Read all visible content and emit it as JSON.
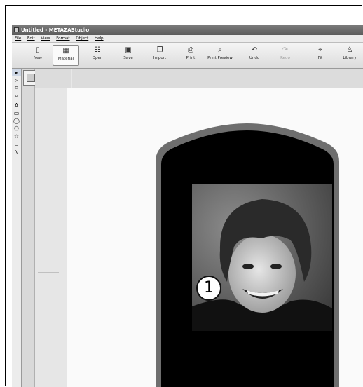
{
  "window": {
    "title": "Untitled - METAZAStudio"
  },
  "menu": {
    "items": [
      "File",
      "Edit",
      "View",
      "Format",
      "Object",
      "Help"
    ]
  },
  "toolbar": {
    "buttons": [
      {
        "label": "New",
        "icon": "new-document-icon",
        "glyph": "▯"
      },
      {
        "label": "Material",
        "icon": "material-icon",
        "glyph": "▦"
      },
      {
        "label": "Open",
        "icon": "open-folder-icon",
        "glyph": "☷"
      },
      {
        "label": "Save",
        "icon": "save-disk-icon",
        "glyph": "▣"
      },
      {
        "label": "Import",
        "icon": "import-icon",
        "glyph": "❐"
      },
      {
        "label": "Print",
        "icon": "printer-icon",
        "glyph": "⎙"
      },
      {
        "label": "Print Preview",
        "icon": "print-preview-icon",
        "glyph": "⌕"
      },
      {
        "label": "Undo",
        "icon": "undo-icon",
        "glyph": "↶"
      },
      {
        "label": "Redo",
        "icon": "redo-icon",
        "glyph": "↷"
      },
      {
        "label": "Fit",
        "icon": "fit-icon",
        "glyph": "⌖"
      },
      {
        "label": "Library",
        "icon": "library-icon",
        "glyph": "♙"
      }
    ]
  },
  "tools": {
    "items": [
      {
        "name": "select-arrow-icon",
        "glyph": "▸"
      },
      {
        "name": "node-select-icon",
        "glyph": "▹"
      },
      {
        "name": "crop-icon",
        "glyph": "⌑"
      },
      {
        "name": "zoom-icon",
        "glyph": "⌕"
      },
      {
        "name": "text-icon",
        "glyph": "A"
      },
      {
        "name": "rectangle-icon",
        "glyph": "▭"
      },
      {
        "name": "ellipse-icon",
        "glyph": "◯"
      },
      {
        "name": "polygon-icon",
        "glyph": "⬠"
      },
      {
        "name": "star-icon",
        "glyph": "☆"
      },
      {
        "name": "line-icon",
        "glyph": "⨽"
      },
      {
        "name": "curve-icon",
        "glyph": "∿"
      }
    ]
  },
  "callout": {
    "number": "1"
  },
  "colors": {
    "shape_fill": "#000000",
    "shape_border": "#6e6e6e",
    "paper": "#fafafa",
    "canvas_bg": "#cfcfcf"
  }
}
